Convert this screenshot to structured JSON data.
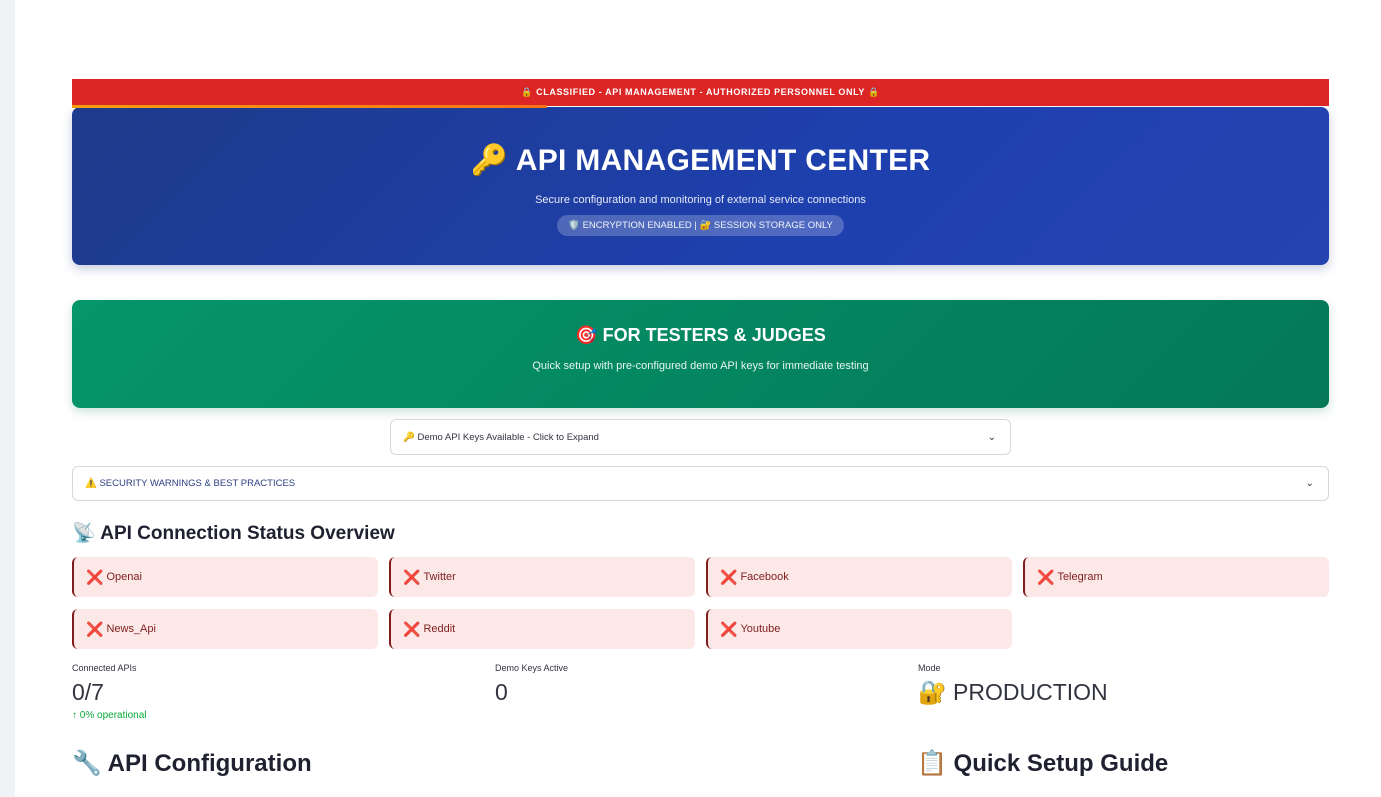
{
  "banner": {
    "classified_text": "🔒 CLASSIFIED - API MANAGEMENT - AUTHORIZED PERSONNEL ONLY 🔒"
  },
  "hero": {
    "title": "🔑 API MANAGEMENT CENTER",
    "subtitle": "Secure configuration and monitoring of external service connections",
    "badge": "🛡️ ENCRYPTION ENABLED | 🔐 SESSION STORAGE ONLY"
  },
  "testers": {
    "title": "🎯 FOR TESTERS & JUDGES",
    "subtitle": "Quick setup with pre-configured demo API keys for immediate testing"
  },
  "demo_expander": {
    "label": "🔑 Demo API Keys Available - Click to Expand"
  },
  "security_expander": {
    "label": "⚠️ SECURITY WARNINGS & BEST PRACTICES"
  },
  "status": {
    "heading": "📡 API Connection Status Overview",
    "icon_name": "x-icon",
    "icon_glyph": "❌",
    "status_color": "#dc2626",
    "items": [
      {
        "label": "Openai"
      },
      {
        "label": "Twitter"
      },
      {
        "label": "Facebook"
      },
      {
        "label": "Telegram"
      },
      {
        "label": "News_Api"
      },
      {
        "label": "Reddit"
      },
      {
        "label": "Youtube"
      }
    ]
  },
  "metrics": {
    "connected": {
      "label": "Connected APIs",
      "value": "0/7",
      "delta": "0% operational"
    },
    "demo": {
      "label": "Demo Keys Active",
      "value": "0"
    },
    "mode": {
      "label": "Mode",
      "value": "🔐 PRODUCTION"
    }
  },
  "sections": {
    "config_heading": "🔧 API Configuration",
    "guide_heading": "📋 Quick Setup Guide"
  },
  "colors": {
    "danger": "#dc2626",
    "hero": "#1e40af",
    "success_panel": "#059669",
    "delta_green": "#09ab3b"
  }
}
